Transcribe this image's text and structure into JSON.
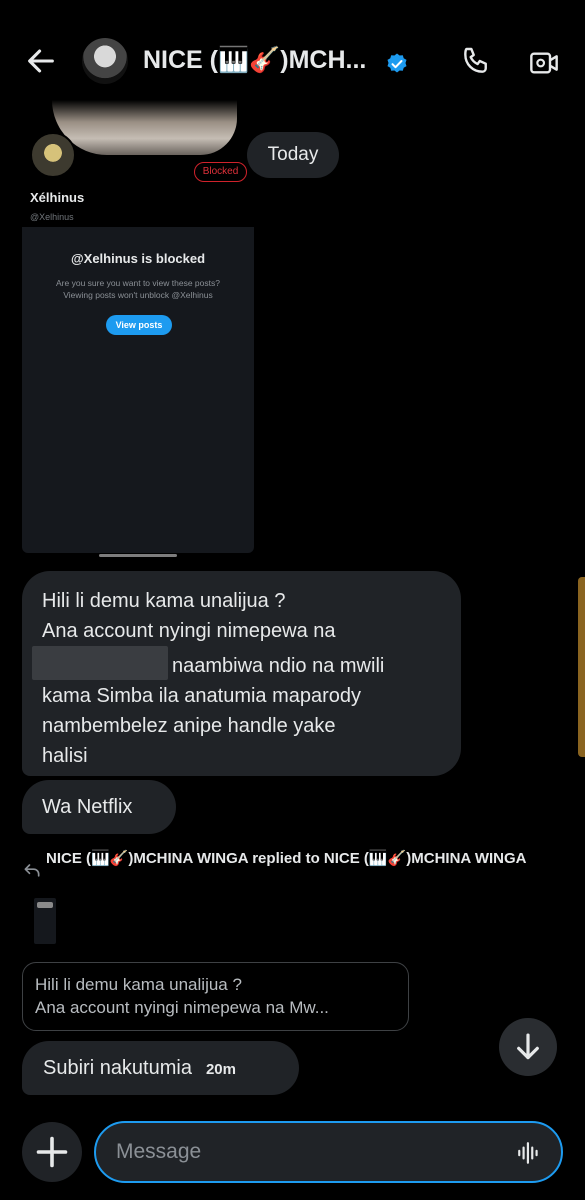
{
  "header": {
    "title": "NICE (🎹🎸)MCH...",
    "back_icon": "arrow-left-icon",
    "call_icon": "phone-icon",
    "video_icon": "video-camera-icon",
    "verified_color": "#1d9bf0"
  },
  "shared_post": {
    "name": "Xélhinus",
    "handle": "@Xelhinus",
    "badge": "Blocked",
    "blocked_title": "@Xelhinus is blocked",
    "blocked_line1": "Are you sure you want to view these posts?",
    "blocked_line2": "Viewing posts won't unblock @Xelhinus",
    "view_button": "View posts"
  },
  "date_separator": "Today",
  "messages": [
    {
      "lines": [
        "Hili li demu kama unalijua ?",
        "Ana account nyingi nimepewa na",
        "naambiwa ndio na mwili",
        "kama Simba ila anatumia maparody",
        "nambembelez anipe handle yake",
        "halisi"
      ]
    },
    {
      "text": "Wa Netflix"
    }
  ],
  "reply": {
    "label": "NICE (🎹🎸)MCHINA WINGA replied to NICE (🎹🎸)MCHINA WINGA",
    "quote_line1": "Hili li demu kama unalijua ?",
    "quote_line2": "Ana account nyingi nimepewa na Mw...",
    "text": "Subiri nakutumia",
    "time": "20m"
  },
  "composer": {
    "placeholder": "Message",
    "plus_icon": "plus-icon",
    "voice_icon": "voice-wave-icon",
    "accent": "#1d9bf0"
  }
}
